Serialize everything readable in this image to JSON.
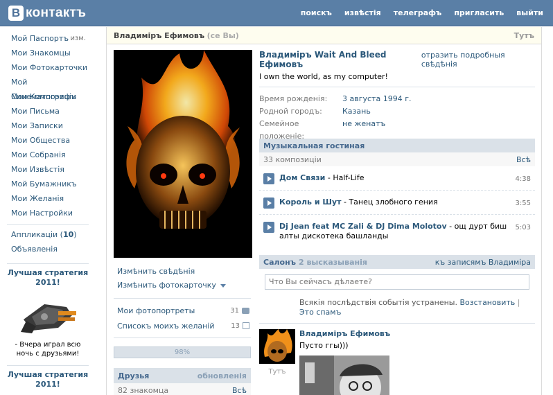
{
  "header": {
    "logo_letter": "В",
    "logo_text": "контактъ",
    "nav": [
      "поискъ",
      "извѣстія",
      "телеграфъ",
      "пригласить",
      "выйти"
    ]
  },
  "leftnav": {
    "passport": "Мой Паспортъ",
    "edit": "изм.",
    "items": [
      "Мои Знакомцы",
      "Мои Фотокарточки",
      "Мой Синематографъ",
      "Мои Композиціи",
      "Мои Письма",
      "Мои Записки",
      "Мои Общества",
      "Мои Собранія",
      "Мои Извѣстія",
      "Мой Бумажникъ",
      "Мои Желанія",
      "Мои Настройки"
    ],
    "apps_label": "Аппликаціи",
    "apps_count": "10",
    "ads": "Объявленія",
    "promo": {
      "title": "Лучшая стратегия 2011!",
      "text": "- Вчера играл всю ночь с друзьями!"
    },
    "promo2_title": "Лучшая стратегия 2011!"
  },
  "titlebar": {
    "name": "Владиміръ Ефимовъ",
    "you": "(се Вы)",
    "here": "Тутъ"
  },
  "profile": {
    "links": [
      "Измѣнить свѣдѣнія",
      "Измѣнить фотокарточку"
    ],
    "albums": [
      {
        "label": "Мои фотопортреты",
        "count": "31"
      },
      {
        "label": "Списокъ моихъ желаній",
        "count": "13"
      }
    ],
    "progress": "98%",
    "friends": {
      "title": "Друзья",
      "updates": "обновленія",
      "count": "82 знакомца",
      "all": "Всѣ"
    }
  },
  "info": {
    "fullname": "Владиміръ Wait And Bleed Ефимовъ",
    "details_link": "отразить подробныя свѣдѣнія",
    "status": "I own the world, as my computer!",
    "rows": [
      {
        "label": "Время рожденія:",
        "value": "3 августа 1994 г."
      },
      {
        "label": "Родной городъ:",
        "value": "Казань"
      },
      {
        "label": "Семейное положеніе:",
        "value": "не женатъ"
      }
    ]
  },
  "music": {
    "title": "Музыкальная гостиная",
    "count": "33 композиціи",
    "all": "Всѣ",
    "tracks": [
      {
        "artist": "Дом Связи",
        "title": " - Half-Life",
        "duration": "4:38"
      },
      {
        "artist": "Король и Шут",
        "title": " - Танец злобного гения",
        "duration": "3:55"
      },
      {
        "artist": "Dj Jean feat MC Zali & DJ Dima Molotov",
        "title": " - ощ дурт биш алты дискотека башланды",
        "duration": "5:03"
      }
    ]
  },
  "wall": {
    "title": "Салонъ",
    "count": "2 высказыванія",
    "to_records": "къ записямъ Владиміра",
    "placeholder": "Что Вы сейчасъ дѣлаете?",
    "restored_text": "Всякія послѣдствія событія устранены.",
    "restore": "Возстановить",
    "spam": "Это спамъ",
    "post": {
      "author": "Владиміръ Ефимовъ",
      "text": "Пусто ггы)))",
      "when": "Тутъ"
    }
  },
  "colors": {
    "header": "#5a7fa6",
    "link": "#2b587a",
    "section": "#dae1e8"
  }
}
